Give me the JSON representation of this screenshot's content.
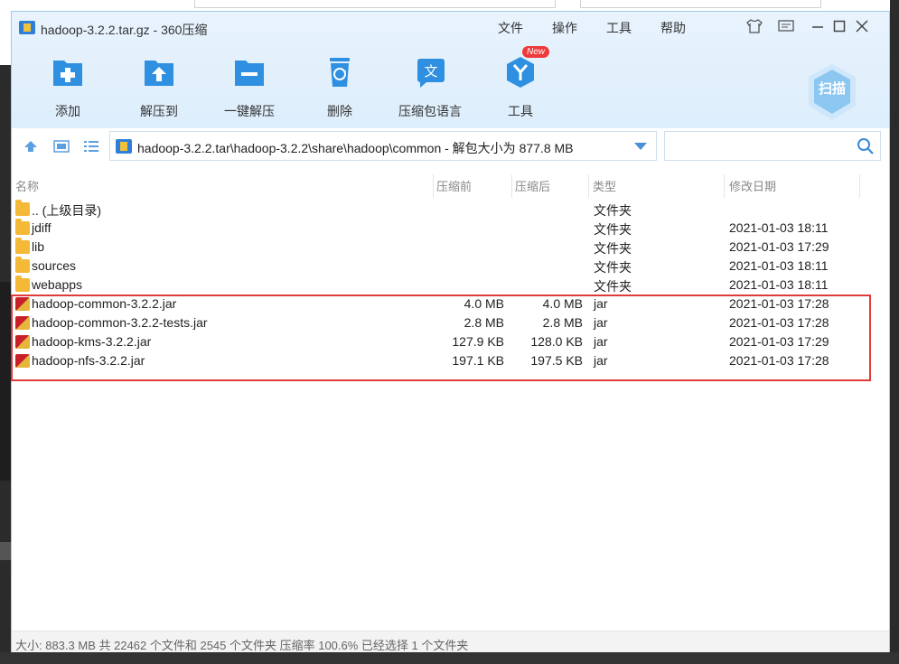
{
  "window": {
    "title": "hadoop-3.2.2.tar.gz - 360压缩",
    "menu": [
      "文件",
      "操作",
      "工具",
      "帮助"
    ]
  },
  "toolbar": {
    "items": [
      {
        "label": "添加",
        "icon": "add-icon"
      },
      {
        "label": "解压到",
        "icon": "extract-to-icon"
      },
      {
        "label": "一键解压",
        "icon": "one-click-extract-icon"
      },
      {
        "label": "删除",
        "icon": "delete-icon"
      },
      {
        "label": "压缩包语言",
        "icon": "language-icon"
      },
      {
        "label": "工具",
        "icon": "tools-icon"
      }
    ],
    "new_badge": "New",
    "scan_label": "扫描"
  },
  "path": {
    "text": "hadoop-3.2.2.tar\\hadoop-3.2.2\\share\\hadoop\\common - 解包大小为 877.8 MB",
    "search_value": ""
  },
  "columns": {
    "name": "名称",
    "compressed": "压缩前",
    "uncompressed": "压缩后",
    "type": "类型",
    "modified": "修改日期"
  },
  "rows": [
    {
      "name": ".. (上级目录)",
      "compressed": "",
      "uncompressed": "",
      "type": "文件夹",
      "modified": "",
      "kind": "folder"
    },
    {
      "name": "jdiff",
      "compressed": "",
      "uncompressed": "",
      "type": "文件夹",
      "modified": "2021-01-03 18:11",
      "kind": "folder"
    },
    {
      "name": "lib",
      "compressed": "",
      "uncompressed": "",
      "type": "文件夹",
      "modified": "2021-01-03 17:29",
      "kind": "folder"
    },
    {
      "name": "sources",
      "compressed": "",
      "uncompressed": "",
      "type": "文件夹",
      "modified": "2021-01-03 18:11",
      "kind": "folder"
    },
    {
      "name": "webapps",
      "compressed": "",
      "uncompressed": "",
      "type": "文件夹",
      "modified": "2021-01-03 18:11",
      "kind": "folder"
    },
    {
      "name": "hadoop-common-3.2.2.jar",
      "compressed": "4.0 MB",
      "uncompressed": "4.0 MB",
      "type": "jar",
      "modified": "2021-01-03 17:28",
      "kind": "jar"
    },
    {
      "name": "hadoop-common-3.2.2-tests.jar",
      "compressed": "2.8 MB",
      "uncompressed": "2.8 MB",
      "type": "jar",
      "modified": "2021-01-03 17:28",
      "kind": "jar"
    },
    {
      "name": "hadoop-kms-3.2.2.jar",
      "compressed": "127.9 KB",
      "uncompressed": "128.0 KB",
      "type": "jar",
      "modified": "2021-01-03 17:29",
      "kind": "jar"
    },
    {
      "name": "hadoop-nfs-3.2.2.jar",
      "compressed": "197.1 KB",
      "uncompressed": "197.5 KB",
      "type": "jar",
      "modified": "2021-01-03 17:28",
      "kind": "jar"
    }
  ],
  "status": "大小: 883.3 MB 共 22462 个文件和 2545 个文件夹 压缩率 100.6% 已经选择 1 个文件夹",
  "colors": {
    "accent": "#2f8fe0",
    "highlight_border": "#e23a3a",
    "folder": "#f4b936"
  }
}
